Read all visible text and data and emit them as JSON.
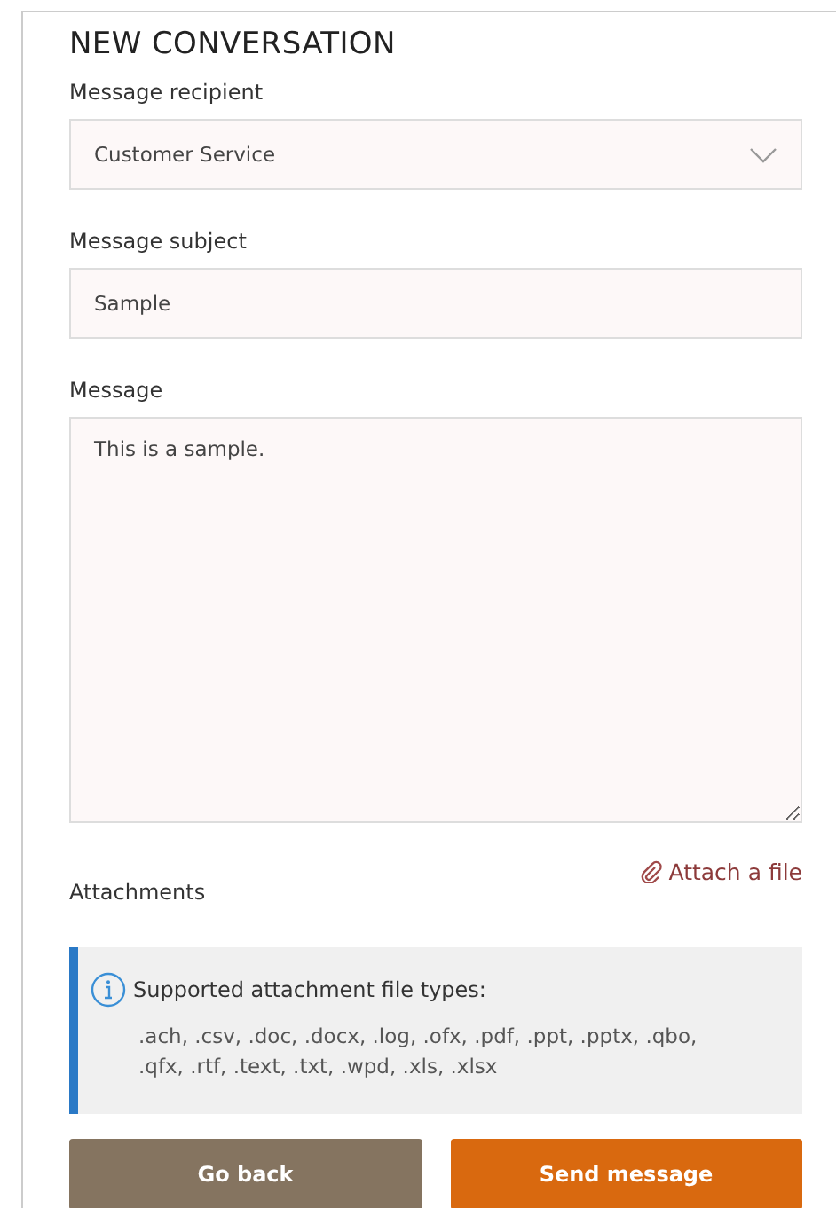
{
  "title": "NEW CONVERSATION",
  "fields": [
    {
      "kind": "select",
      "label": "Message recipient",
      "value": "Customer Service"
    },
    {
      "kind": "text",
      "label": "Message subject",
      "value": "Sample"
    },
    {
      "kind": "textarea",
      "label": "Message",
      "value": "This is a sample."
    }
  ],
  "attachments": {
    "label": "Attachments",
    "link": "Attach a file"
  },
  "info": {
    "heading": "Supported attachment file types:",
    "types": ".ach,  .csv,  .doc,  .docx,  .log,  .ofx,  .pdf,  .ppt,  .pptx,  .qbo,  .qfx,  .rtf,  .text,  .txt,  .wpd,  .xls,  .xlsx"
  },
  "buttons": [
    {
      "kind": "secondary",
      "label": "Go back"
    },
    {
      "kind": "primary",
      "label": "Send message"
    }
  ]
}
